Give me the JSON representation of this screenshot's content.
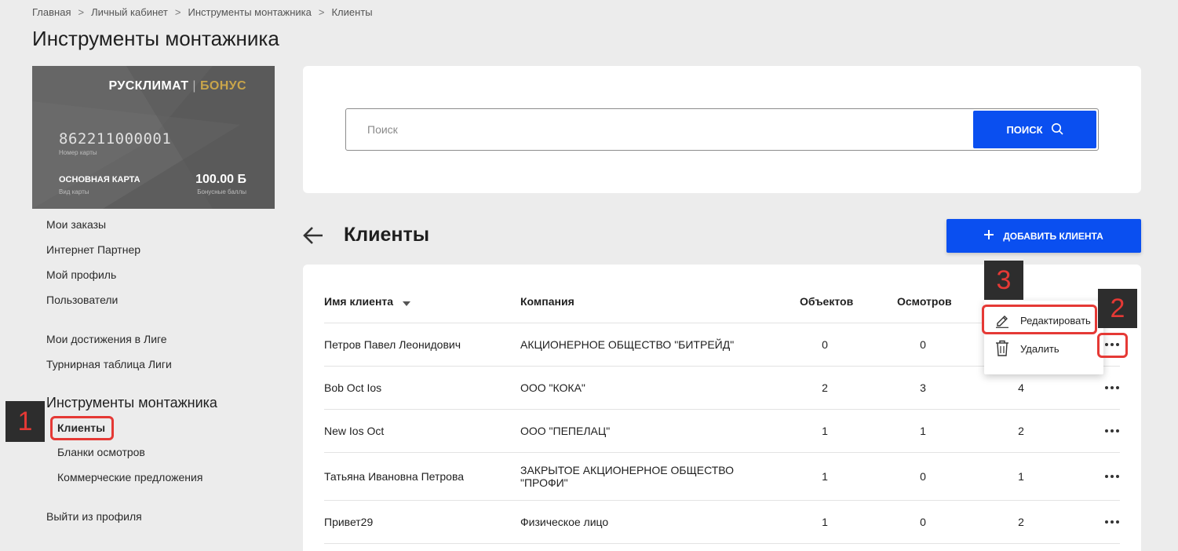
{
  "breadcrumb": [
    "Главная",
    "Личный кабинет",
    "Инструменты монтажника",
    "Клиенты"
  ],
  "breadcrumb_separator": ">",
  "page_title": "Инструменты монтажника",
  "card": {
    "brand": "РУСКЛИМАТ",
    "brand_pipe": "|",
    "brand_bonus": "БОНУС",
    "number": "862211000001",
    "number_label": "Номер карты",
    "type": "ОСНОВНАЯ КАРТА",
    "type_label": "Вид карты",
    "points": "100.00 Б",
    "points_label": "Бонусные баллы"
  },
  "sidebar": {
    "links": [
      "Мои заказы",
      "Интернет Партнер",
      "Мой профиль",
      "Пользователи",
      "Мои достижения в Лиге",
      "Турнирная таблица Лиги"
    ],
    "section_title": "Инструменты монтажника",
    "sub_links": [
      "Клиенты",
      "Бланки осмотров",
      "Коммерческие предложения"
    ],
    "logout": "Выйти из профиля"
  },
  "search": {
    "placeholder": "Поиск",
    "button_label": "ПОИСК"
  },
  "clients": {
    "title": "Клиенты",
    "add_button_label": "ДОБАВИТЬ КЛИЕНТА",
    "columns": {
      "name": "Имя клиента",
      "company": "Компания",
      "objects": "Объектов",
      "inspections": "Осмотров"
    },
    "rows": [
      {
        "name": "Петров Павел Леонидович",
        "company": "АКЦИОНЕРНОЕ ОБЩЕСТВО \"БИТРЕЙД\"",
        "objects": "0",
        "inspections": "0",
        "third": ""
      },
      {
        "name": "Bob Oct Ios",
        "company": "ООО \"КОКА\"",
        "objects": "2",
        "inspections": "3",
        "third": "4"
      },
      {
        "name": "New Ios Oct",
        "company": "ООО \"ПЕПЕЛАЦ\"",
        "objects": "1",
        "inspections": "1",
        "third": "2"
      },
      {
        "name": "Татьяна Ивановна Петрова",
        "company": "ЗАКРЫТОЕ АКЦИОНЕРНОЕ ОБЩЕСТВО \"ПРОФИ\"",
        "objects": "1",
        "inspections": "0",
        "third": "1"
      },
      {
        "name": "Привет29",
        "company": "Физическое лицо",
        "objects": "1",
        "inspections": "0",
        "third": "2"
      }
    ]
  },
  "context_menu": {
    "edit": "Редактировать",
    "delete": "Удалить"
  },
  "annotations": {
    "step1": "1",
    "step2": "2",
    "step3": "3",
    "color": "#e53935"
  },
  "colors": {
    "accent": "#0a4ff0",
    "background": "#ececec",
    "card": "#5d5d5d",
    "bonus_gold": "#c9a54a"
  }
}
